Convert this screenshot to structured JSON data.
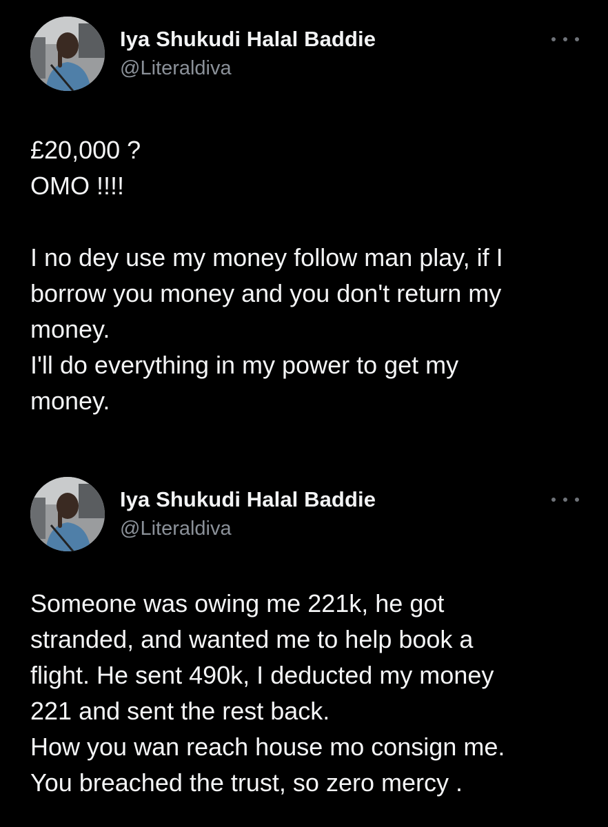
{
  "colors": {
    "background": "#000000",
    "text": "#f4f5f6",
    "handle": "#8b9199",
    "more_dots": "#6f7379"
  },
  "tweets": [
    {
      "author": {
        "display_name": "Iya Shukudi Halal Baddie",
        "handle": "@Literaldiva",
        "avatar_icon": "avatar-photo"
      },
      "more_icon": "more-horizontal-icon",
      "lines": [
        "£20,000 ?",
        "OMO !!!!",
        "",
        "I no dey use my money follow man play, if I",
        "borrow you money and you don't return my",
        "money.",
        "I'll do everything in my power to get my",
        "money."
      ]
    },
    {
      "author": {
        "display_name": "Iya Shukudi Halal Baddie",
        "handle": "@Literaldiva",
        "avatar_icon": "avatar-photo"
      },
      "more_icon": "more-horizontal-icon",
      "lines": [
        "Someone was owing me 221k, he got",
        "stranded, and wanted me to help  book a",
        "flight. He sent 490k, I deducted my money",
        "221 and sent the rest back.",
        "How you wan reach house mo consign me.",
        "You breached the trust, so zero mercy ."
      ]
    }
  ]
}
